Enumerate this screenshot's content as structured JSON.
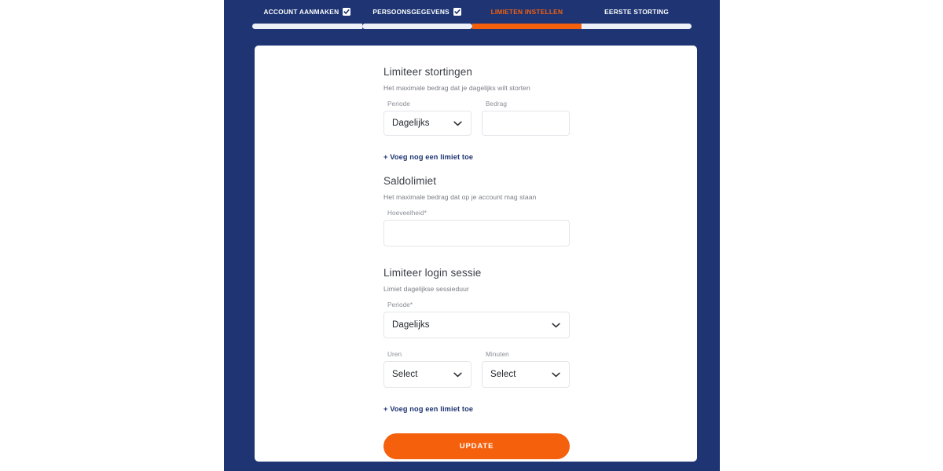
{
  "theme": {
    "navy": "#1e3473",
    "orange": "#f4600c",
    "card_bg": "#ffffff",
    "border": "#e4e6ea",
    "muted_text": "#7a7d85",
    "heading_text": "#3c3f48"
  },
  "stepper": {
    "steps": [
      {
        "label": "ACCOUNT AANMAKEN",
        "completed": true,
        "active": false
      },
      {
        "label": "PERSOONSGEGEVENS",
        "completed": true,
        "active": false
      },
      {
        "label": "LIMIETEN INSTELLEN",
        "completed": false,
        "active": true
      },
      {
        "label": "EERSTE STORTING",
        "completed": false,
        "active": false
      }
    ]
  },
  "form": {
    "deposit_section": {
      "title": "Limiteer stortingen",
      "subtitle": "Het maximale bedrag dat je dagelijks wilt storten",
      "period_label": "Periode",
      "period_value": "Dagelijks",
      "amount_label": "Bedrag",
      "amount_value": "",
      "amount_placeholder": "",
      "add_limit_link": "+ Voeg nog een limiet toe"
    },
    "balance_section": {
      "title": "Saldolimiet",
      "subtitle": "Het maximale bedrag dat op je account mag staan",
      "amount_label": "Hoeveelheid*",
      "amount_value": "",
      "amount_placeholder": ""
    },
    "session_section": {
      "title": "Limiteer login sessie",
      "subtitle": "Limiet dagelijkse sessieduur",
      "period_label": "Periode*",
      "period_value": "Dagelijks",
      "hours_label": "Uren",
      "hours_value": "Select",
      "minutes_label": "Minuten",
      "minutes_value": "Select",
      "add_limit_link": "+ Voeg nog een limiet toe"
    },
    "submit_label": "UPDATE"
  }
}
